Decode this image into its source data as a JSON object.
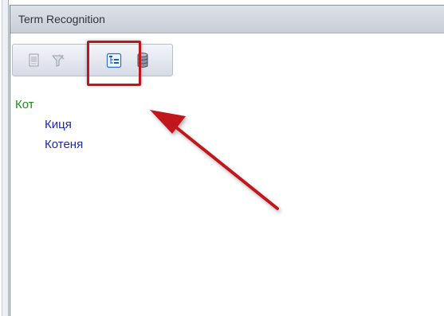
{
  "panel": {
    "title": "Term Recognition"
  },
  "toolbar": {
    "buttons": [
      {
        "icon": "document-icon",
        "state": "disabled"
      },
      {
        "icon": "filter-icon",
        "state": "disabled"
      },
      {
        "icon": "tree-view-icon",
        "state": "active"
      },
      {
        "icon": "database-icon",
        "state": "enabled"
      }
    ]
  },
  "tree": {
    "root": {
      "label": "Кот",
      "color": "#1c8c1c"
    },
    "children": [
      {
        "label": "Киця",
        "color": "#1b2aa8"
      },
      {
        "label": "Котеня",
        "color": "#1b2aa8"
      }
    ]
  },
  "annotation": {
    "highlight_color": "#c0151c",
    "arrow_color": "#c0151c"
  }
}
